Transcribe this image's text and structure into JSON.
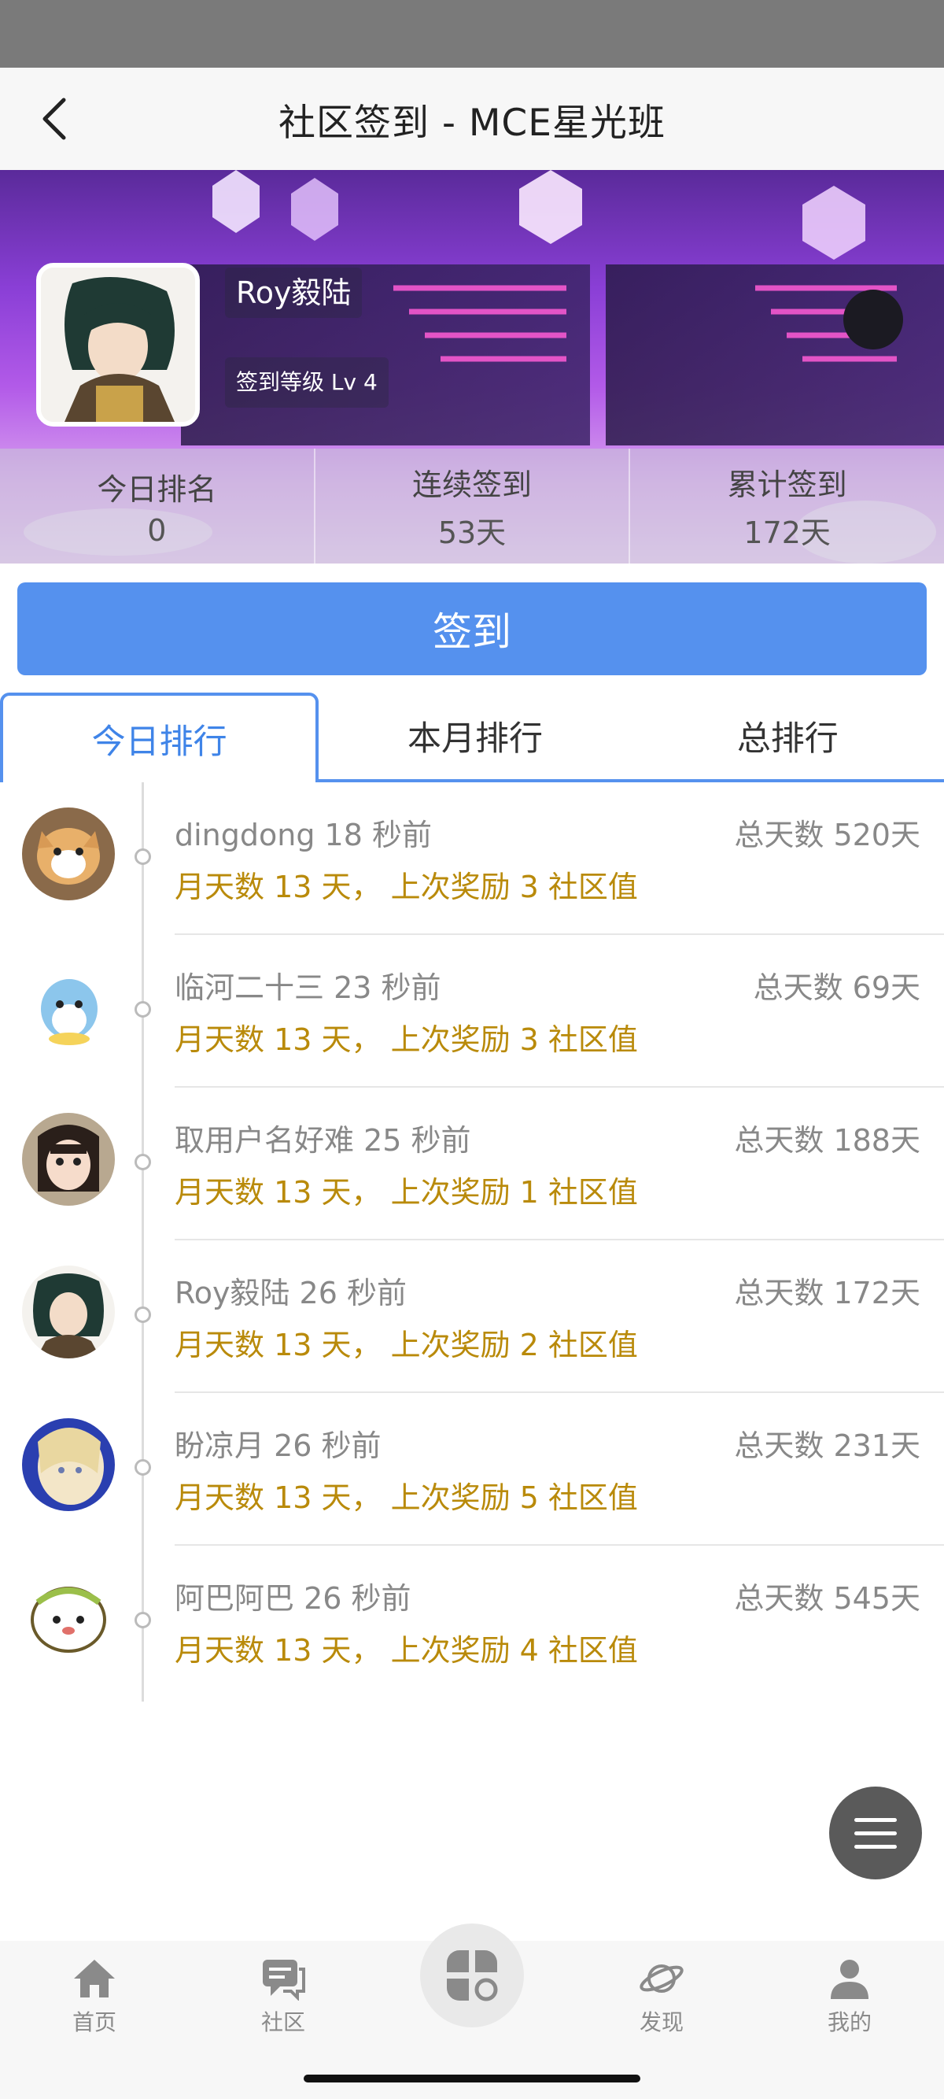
{
  "header": {
    "title": "社区签到 - MCE星光班"
  },
  "profile": {
    "name": "Roy毅陆",
    "level": "签到等级 Lv 4",
    "stats": [
      {
        "label": "今日排名",
        "value": "0"
      },
      {
        "label": "连续签到",
        "value": "53天"
      },
      {
        "label": "累计签到",
        "value": "172天"
      }
    ]
  },
  "checkin_button": {
    "label": "签到"
  },
  "tabs": [
    {
      "label": "今日排行",
      "active": true
    },
    {
      "label": "本月排行",
      "active": false
    },
    {
      "label": "总排行",
      "active": false
    }
  ],
  "ranking": [
    {
      "name_time": "dingdong 18 秒前",
      "total": "总天数 520天",
      "detail": "月天数 13 天， 上次奖励 3 社区值"
    },
    {
      "name_time": "临河二十三 23 秒前",
      "total": "总天数 69天",
      "detail": "月天数 13 天， 上次奖励 3 社区值"
    },
    {
      "name_time": "取用户名好难 25 秒前",
      "total": "总天数 188天",
      "detail": "月天数 13 天， 上次奖励 1 社区值"
    },
    {
      "name_time": "Roy毅陆 26 秒前",
      "total": "总天数 172天",
      "detail": "月天数 13 天， 上次奖励 2 社区值"
    },
    {
      "name_time": "盼凉月 26 秒前",
      "total": "总天数 231天",
      "detail": "月天数 13 天， 上次奖励 5 社区值"
    },
    {
      "name_time": "阿巴阿巴 26 秒前",
      "total": "总天数 545天",
      "detail": "月天数 13 天， 上次奖励 4 社区值"
    }
  ],
  "tabbar": {
    "items": [
      {
        "label": "首页",
        "icon": "home-icon"
      },
      {
        "label": "社区",
        "icon": "chat-icon"
      },
      {
        "label": "",
        "icon": "apps-icon"
      },
      {
        "label": "发现",
        "icon": "planet-icon"
      },
      {
        "label": "我的",
        "icon": "user-icon"
      }
    ]
  },
  "colors": {
    "accent": "#5591ee",
    "gold": "#b98a0a",
    "muted": "#888888"
  }
}
